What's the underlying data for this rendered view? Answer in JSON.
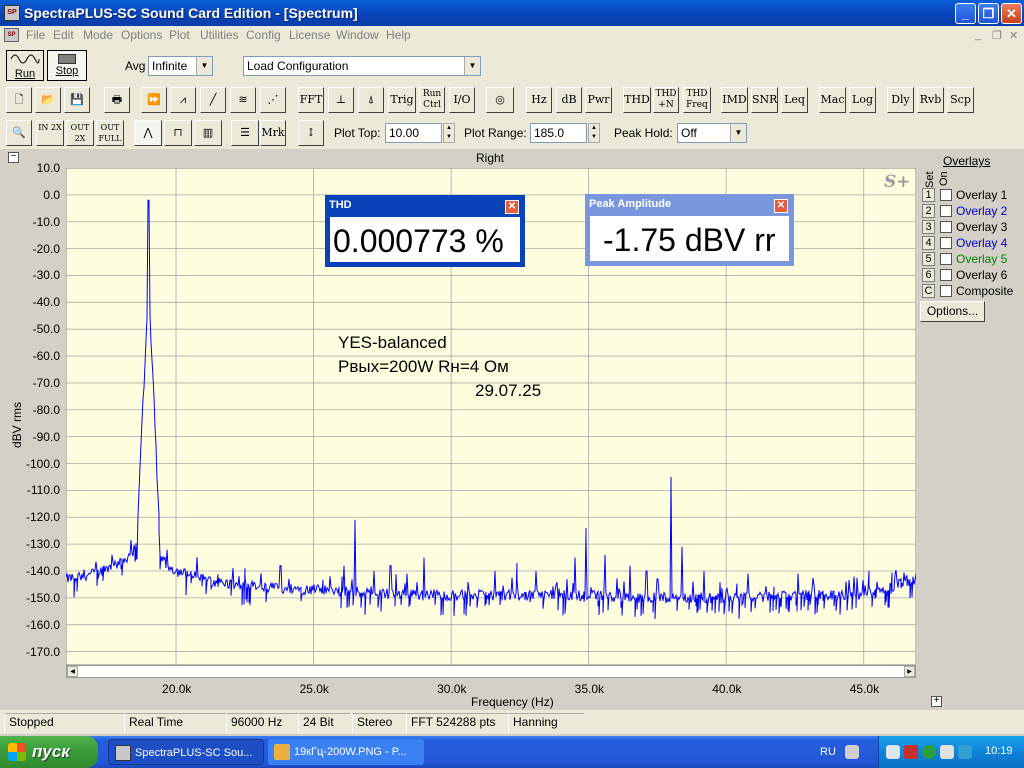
{
  "window": {
    "title": "SpectraPLUS-SC Sound Card Edition - [Spectrum]",
    "app_icon_text": "SP"
  },
  "menu": [
    "File",
    "Edit",
    "Mode",
    "Options",
    "Plot",
    "Utilities",
    "Config",
    "License",
    "Window",
    "Help"
  ],
  "toolbar1": {
    "run_label": "Run",
    "stop_label": "Stop",
    "avg_label": "Avg",
    "avg_value": "Infinite",
    "config_value": "Load Configuration"
  },
  "toolbar2": {
    "text_buttons": [
      "FFT",
      "Trig",
      "Run Ctrl",
      "I/O",
      "Hz",
      "dB",
      "Pwr",
      "THD",
      "THD +N",
      "THD Freq",
      "IMD",
      "SNR",
      "Leq",
      "Mac",
      "Log",
      "Dly",
      "Rvb",
      "Scp"
    ]
  },
  "toolbar3": {
    "zoom_in": "IN 2X",
    "zoom_out": "OUT 2X",
    "zoom_full": "OUT FULL",
    "mrk": "Mrk",
    "plot_top_label": "Plot Top:",
    "plot_top_value": "10.00",
    "plot_range_label": "Plot Range:",
    "plot_range_value": "185.0",
    "peak_hold_label": "Peak Hold:",
    "peak_hold_value": "Off"
  },
  "plot": {
    "title": "Right",
    "watermark": "S+",
    "annotation_lines": [
      "YES-balanced",
      "Pвых=200W   Rн=4 Ом",
      "29.07.25"
    ]
  },
  "chart_data": {
    "type": "line",
    "title": "Right",
    "xlabel": "Frequency (Hz)",
    "ylabel": "dBV rms",
    "x_tick_labels": [
      "20.0k",
      "25.0k",
      "30.0k",
      "35.0k",
      "40.0k",
      "45.0k"
    ],
    "x_ticks": [
      20000,
      25000,
      30000,
      35000,
      40000,
      45000
    ],
    "y_tick_labels": [
      "10.0",
      "0.0",
      "-10.0",
      "-20.0",
      "-30.0",
      "-40.0",
      "-50.0",
      "-60.0",
      "-70.0",
      "-80.0",
      "-90.0",
      "-100.0",
      "-110.0",
      "-120.0",
      "-130.0",
      "-140.0",
      "-150.0",
      "-160.0",
      "-170.0"
    ],
    "xlim": [
      16000,
      46900
    ],
    "ylim": [
      -175,
      10
    ],
    "grid": true,
    "series": [
      {
        "color": "#0000ff",
        "noise_floor": [
          [
            16000,
            -143
          ],
          [
            17000,
            -141
          ],
          [
            18000,
            -137
          ],
          [
            18700,
            -130
          ],
          [
            19000,
            -128
          ],
          [
            19500,
            -136
          ],
          [
            20000,
            -140
          ],
          [
            21000,
            -143
          ],
          [
            22000,
            -145
          ],
          [
            23000,
            -146
          ],
          [
            25000,
            -147
          ],
          [
            27000,
            -148
          ],
          [
            29000,
            -149
          ],
          [
            31000,
            -149
          ],
          [
            33000,
            -149
          ],
          [
            35000,
            -149
          ],
          [
            37000,
            -150
          ],
          [
            39000,
            -150
          ],
          [
            41000,
            -150
          ],
          [
            43000,
            -149
          ],
          [
            45000,
            -149
          ],
          [
            46000,
            -146
          ],
          [
            46900,
            -143
          ]
        ],
        "peaks": [
          [
            19000,
            -2
          ],
          [
            22500,
            -139
          ],
          [
            23800,
            -138
          ],
          [
            25600,
            -142
          ],
          [
            26100,
            -138
          ],
          [
            26500,
            -121
          ],
          [
            27200,
            -140
          ],
          [
            27800,
            -138
          ],
          [
            28400,
            -141
          ],
          [
            29000,
            -135
          ],
          [
            31600,
            -140
          ],
          [
            32400,
            -137
          ],
          [
            33100,
            -140
          ],
          [
            34500,
            -135
          ],
          [
            34900,
            -124
          ],
          [
            35600,
            -134
          ],
          [
            36500,
            -138
          ],
          [
            37100,
            -140
          ],
          [
            37500,
            -143
          ],
          [
            38000,
            -105
          ],
          [
            38400,
            -131
          ],
          [
            39200,
            -140
          ],
          [
            40800,
            -141
          ],
          [
            42600,
            -141
          ],
          [
            45200,
            -140
          ]
        ]
      }
    ]
  },
  "meters": {
    "thd": {
      "title": "THD",
      "value": "0.000773 %"
    },
    "peak": {
      "title": "Peak Amplitude",
      "value": "-1.75 dBV rr"
    }
  },
  "overlays": {
    "title": "Overlays",
    "set_label": "Set",
    "on_label": "On",
    "items": [
      {
        "num": "1",
        "label": "Overlay 1",
        "color": "#000000"
      },
      {
        "num": "2",
        "label": "Overlay 2",
        "color": "#0000cc"
      },
      {
        "num": "3",
        "label": "Overlay 3",
        "color": "#000000"
      },
      {
        "num": "4",
        "label": "Overlay 4",
        "color": "#0000cc"
      },
      {
        "num": "5",
        "label": "Overlay 5",
        "color": "#008000"
      },
      {
        "num": "6",
        "label": "Overlay 6",
        "color": "#000000"
      },
      {
        "num": "C",
        "label": "Composite",
        "color": "#000000"
      }
    ],
    "options_label": "Options..."
  },
  "status": [
    "Stopped",
    "Real Time",
    "96000 Hz",
    "24 Bit",
    "Stereo",
    "FFT 524288 pts",
    "Hanning"
  ],
  "taskbar": {
    "start_label": "пуск",
    "tasks": [
      "SpectraPLUS-SC Sou...",
      "19кГц-200W.PNG - P..."
    ],
    "lang": "RU",
    "clock": "10:19"
  }
}
